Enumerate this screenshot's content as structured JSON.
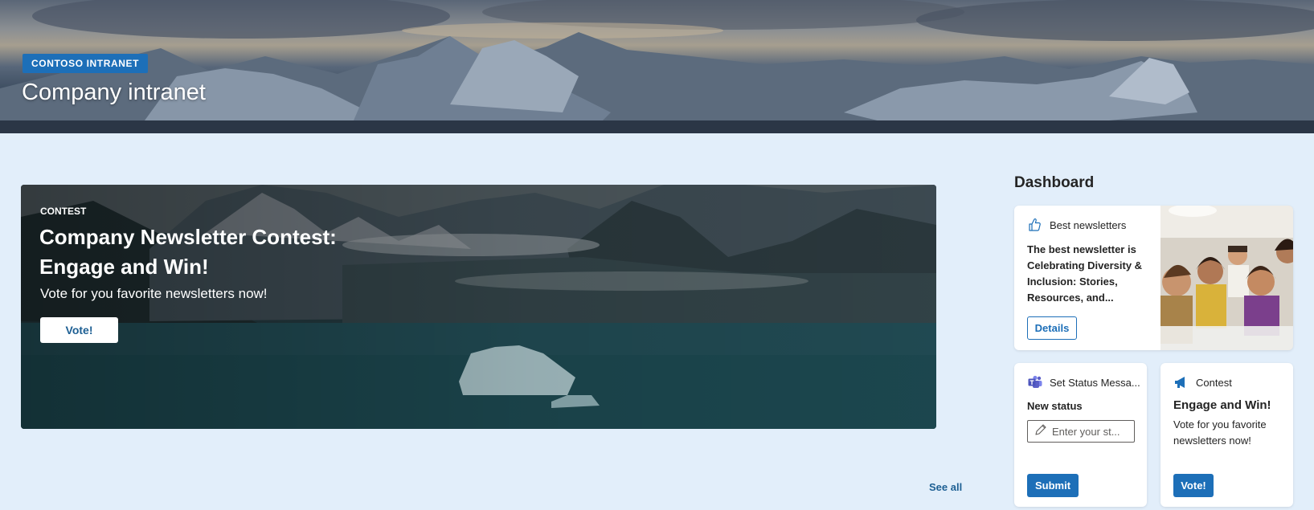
{
  "banner": {
    "site_tag": "CONTOSO INTRANET",
    "title": "Company intranet"
  },
  "hero": {
    "eyebrow": "CONTEST",
    "title": "Company Newsletter Contest: Engage and Win!",
    "subtitle": "Vote for you favorite newsletters now!",
    "button_label": "Vote!"
  },
  "see_all_label": "See all",
  "dashboard": {
    "title": "Dashboard",
    "best_newsletters": {
      "header": "Best newsletters",
      "icon": "thumbs-up-icon",
      "text": "The best newsletter is Celebrating Diversity & Inclusion: Stories, Resources, and...",
      "button_label": "Details"
    },
    "set_status": {
      "header": "Set Status Messa...",
      "icon": "teams-icon",
      "label": "New status",
      "placeholder": "Enter your st...",
      "button_label": "Submit"
    },
    "contest": {
      "header": "Contest",
      "icon": "megaphone-icon",
      "title": "Engage and Win!",
      "body": "Vote for you favorite newsletters now!",
      "button_label": "Vote!"
    }
  },
  "colors": {
    "page_background": "#e2eefa",
    "accent": "#1d6fb8",
    "link": "#1d5f93"
  }
}
